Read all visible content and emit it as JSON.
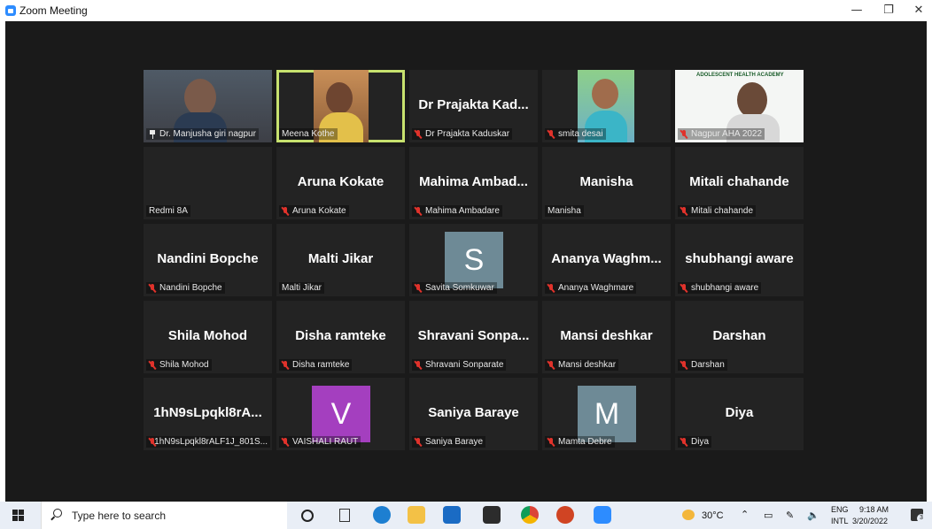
{
  "window": {
    "title": "Zoom Meeting",
    "minimize": "—",
    "maximize": "❐",
    "close": "✕"
  },
  "tiles": [
    {
      "label": "Dr. Manjusha giri nagpur",
      "pinned": true
    },
    {
      "label": "Meena Kothe",
      "active": true
    },
    {
      "big": "Dr Prajakta Kad...",
      "label": "Dr Prajakta Kaduskar",
      "muted": true
    },
    {
      "label": "smita desai",
      "muted": true
    },
    {
      "label": "Nagpur AHA 2022",
      "muted": true,
      "banner": "ADOLESCENT HEALTH ACADEMY"
    },
    {
      "label": "Redmi 8A"
    },
    {
      "big": "Aruna Kokate",
      "label": "Aruna Kokate",
      "muted": true
    },
    {
      "big": "Mahima Ambad...",
      "label": "Mahima Ambadare",
      "muted": true
    },
    {
      "big": "Manisha",
      "label": "Manisha"
    },
    {
      "big": "Mitali chahande",
      "label": "Mitali chahande",
      "muted": true
    },
    {
      "big": "Nandini Bopche",
      "label": "Nandini Bopche",
      "muted": true
    },
    {
      "big": "Malti Jikar",
      "label": "Malti Jikar"
    },
    {
      "avatar": "S",
      "label": "Savita Somkuwar",
      "muted": true
    },
    {
      "big": "Ananya Waghm...",
      "label": "Ananya Waghmare",
      "muted": true
    },
    {
      "big": "shubhangi aware",
      "label": "shubhangi aware",
      "muted": true
    },
    {
      "big": "Shila Mohod",
      "label": "Shila Mohod",
      "muted": true
    },
    {
      "big": "Disha ramteke",
      "label": "Disha ramteke",
      "muted": true
    },
    {
      "big": "Shravani Sonpa...",
      "label": "Shravani Sonparate",
      "muted": true
    },
    {
      "big": "Mansi deshkar",
      "label": "Mansi deshkar",
      "muted": true
    },
    {
      "big": "Darshan",
      "label": "Darshan",
      "muted": true
    },
    {
      "big": "1hN9sLpqkl8rA...",
      "label": "1hN9sLpqkl8rALF1J_801S...",
      "muted": true
    },
    {
      "avatar": "V",
      "label": "VAISHALI RAUT",
      "muted": true
    },
    {
      "big": "Saniya Baraye",
      "label": "Saniya Baraye",
      "muted": true
    },
    {
      "avatar": "M",
      "label": "Mamta Debre",
      "muted": true
    },
    {
      "big": "Diya",
      "label": "Diya",
      "muted": true
    }
  ],
  "colors": {
    "avatar_s": "#6e8a96",
    "avatar_v": "#a43fbf",
    "avatar_m": "#6e8a96",
    "active_border": "#c7e16e",
    "muted_icon": "#e0322b"
  },
  "taskbar": {
    "search_placeholder": "Type here to search",
    "weather": "30°C",
    "language_1": "ENG",
    "language_2": "INTL",
    "time": "9:18 AM",
    "date": "3/20/2022",
    "notification_count": "3",
    "icons": [
      "windows-start-icon",
      "search-icon",
      "task-view-icon",
      "widgets-icon",
      "edge-icon",
      "file-explorer-icon",
      "mail-icon",
      "store-icon",
      "chrome-icon",
      "powerpoint-icon",
      "zoom-icon",
      "weather-icon",
      "chevron-up-icon",
      "network-icon",
      "pen-icon",
      "volume-icon",
      "notification-icon"
    ]
  }
}
